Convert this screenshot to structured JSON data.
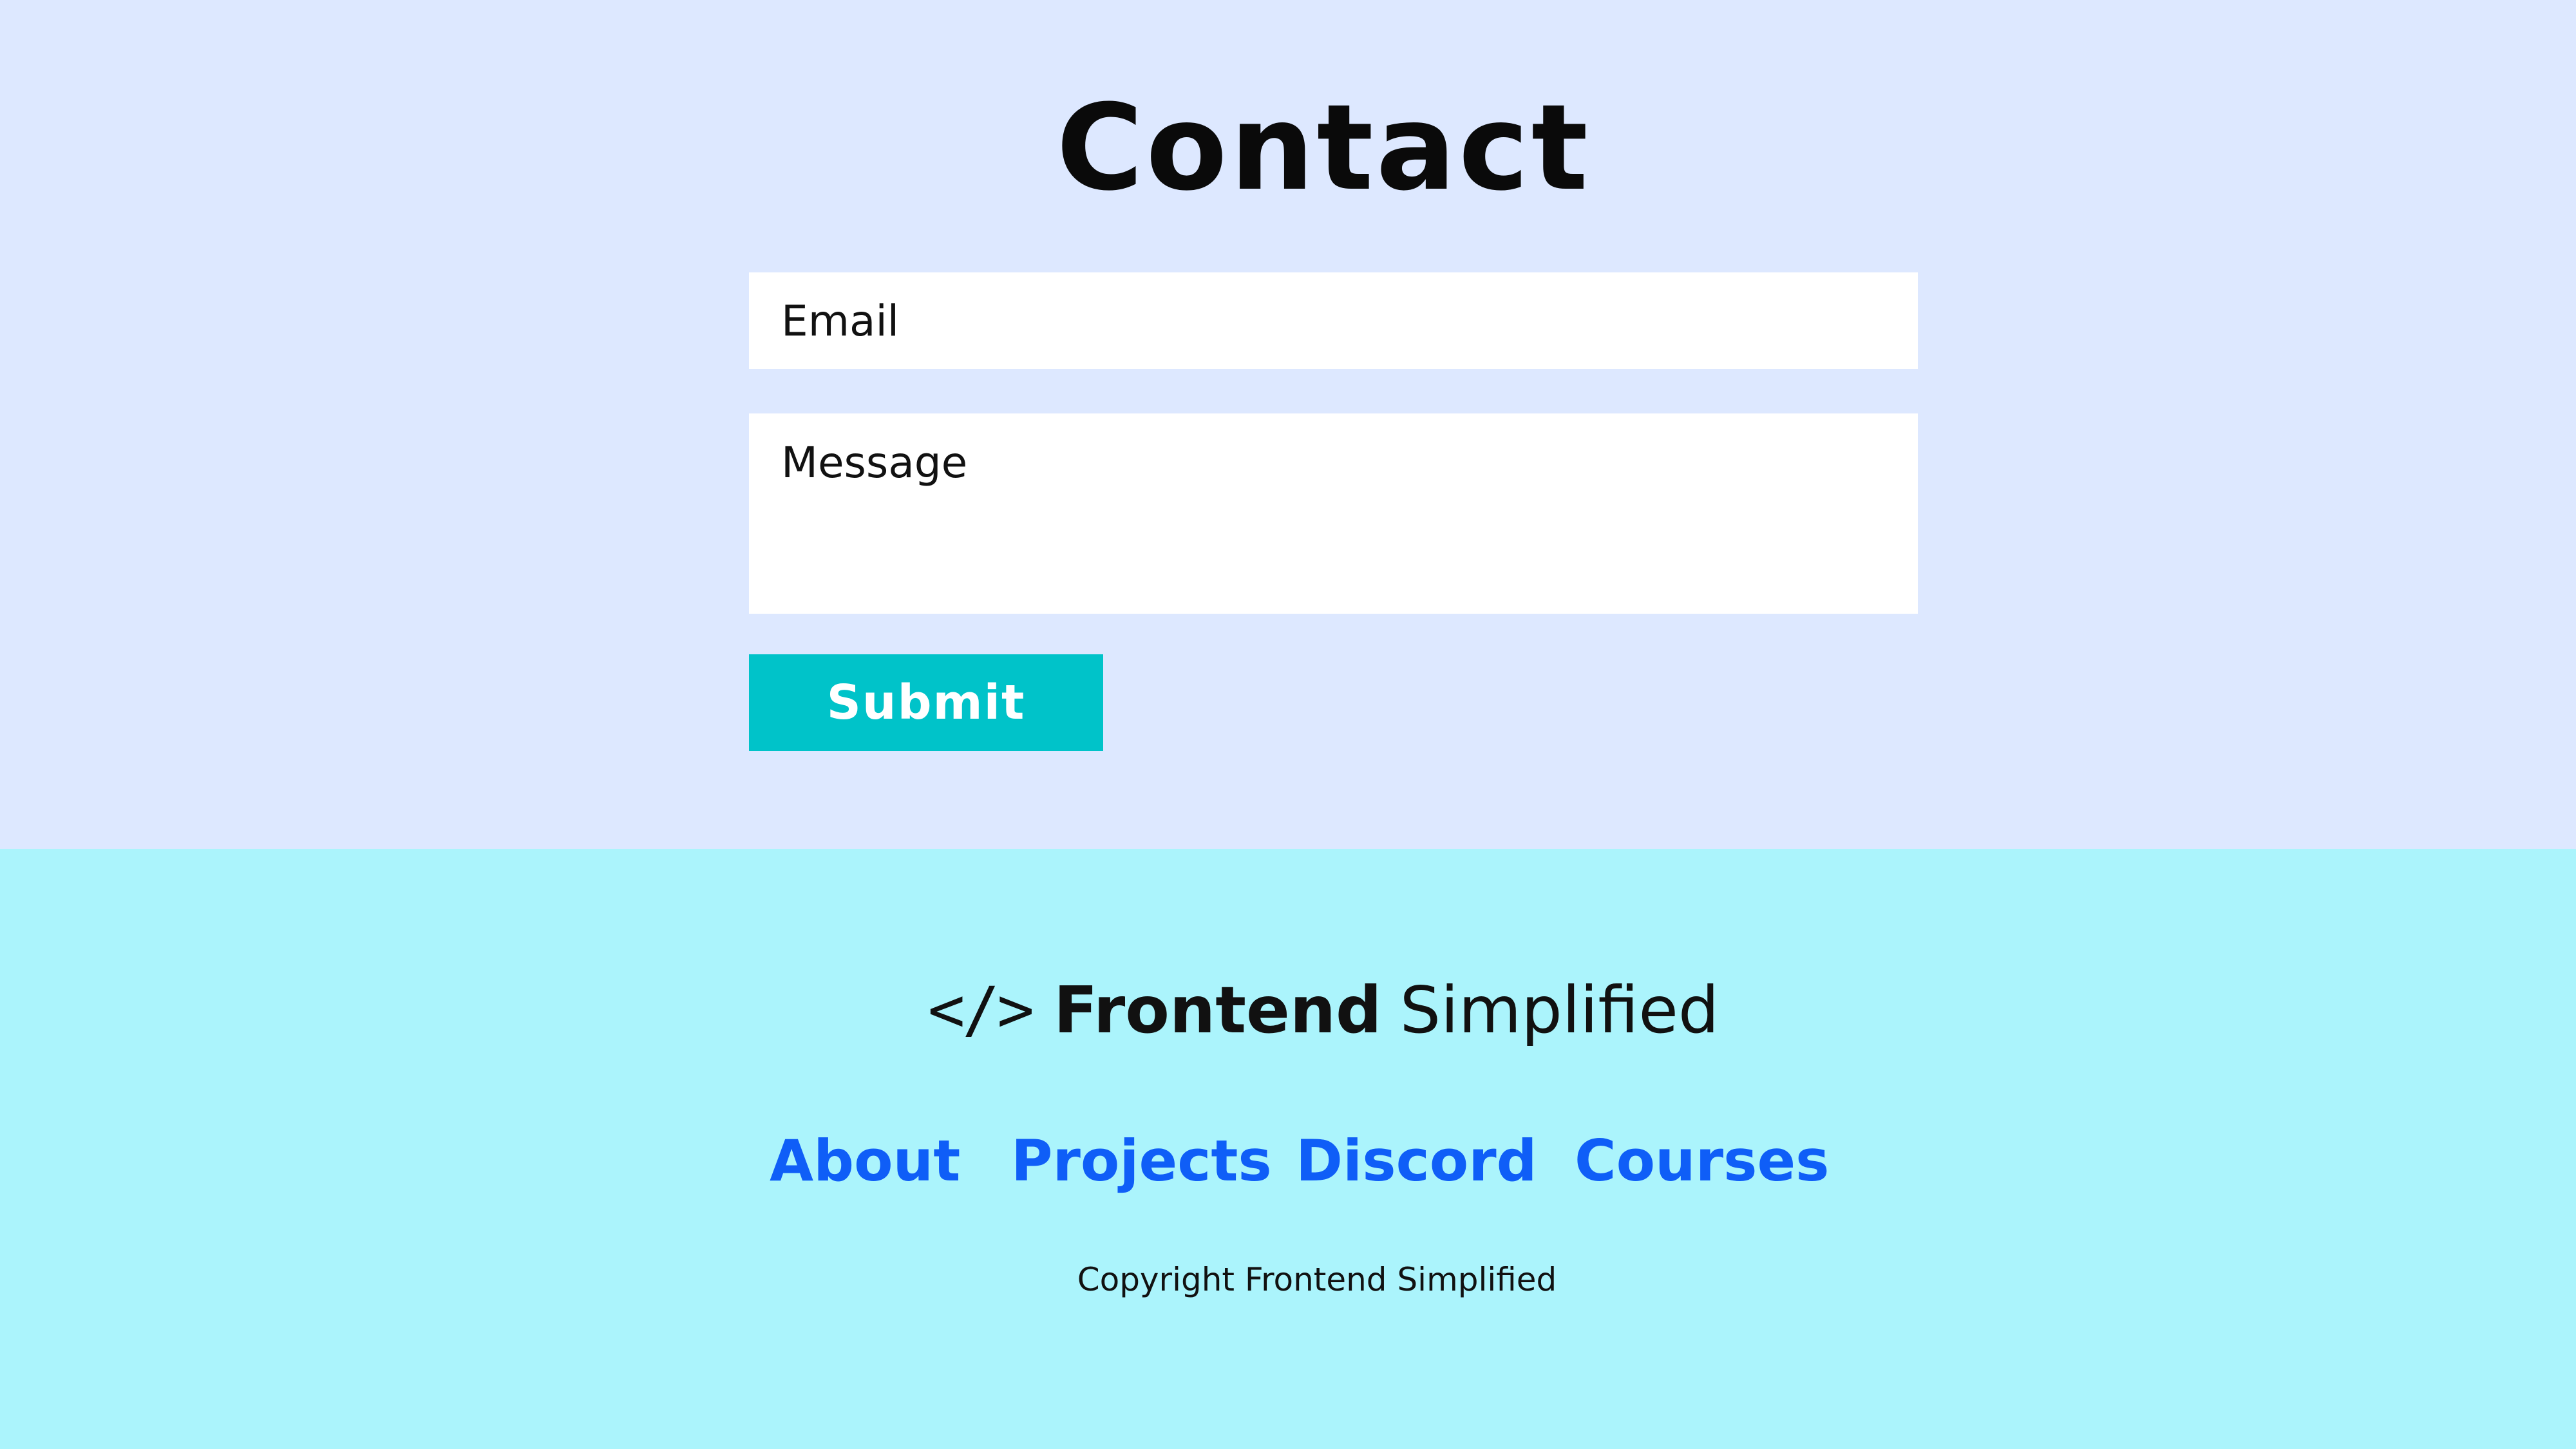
{
  "contact": {
    "title": "Contact",
    "email_placeholder": "Email",
    "message_placeholder": "Message",
    "submit_label": "Submit"
  },
  "footer": {
    "logo_icon": "</>",
    "brand_bold": "Frontend",
    "brand_light": "Simplified",
    "nav": [
      {
        "label": "About"
      },
      {
        "label": "Projects"
      },
      {
        "label": "Discord"
      },
      {
        "label": "Courses"
      }
    ],
    "copyright": "Copyright Frontend Simplified"
  },
  "colors": {
    "contact_background": "#dde8ff",
    "footer_background": "#abf4fc",
    "accent_button": "#00c3c9",
    "link": "#0f5ef7"
  }
}
